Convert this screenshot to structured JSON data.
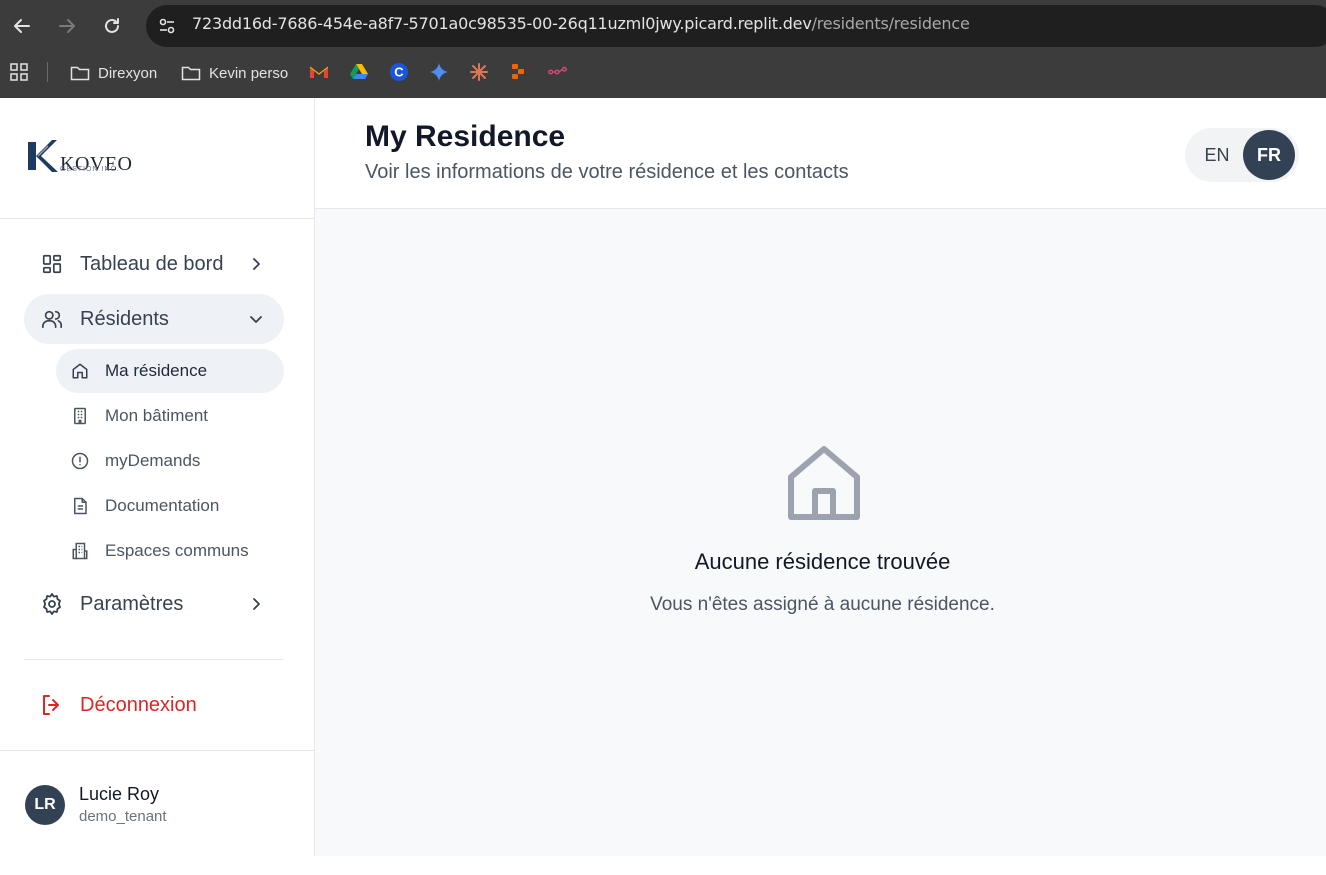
{
  "browser": {
    "url_host": "723dd16d-7686-454e-a8f7-5701a0c98535-00-26q11uzml0jwy.picard.replit.dev",
    "url_path": "/residents/residence",
    "bookmarks": [
      {
        "label": "Direxyon"
      },
      {
        "label": "Kevin perso"
      }
    ]
  },
  "sidebar": {
    "logo": {
      "text": "KOVEO",
      "sub": "GESTION INC."
    },
    "nav": {
      "dashboard": "Tableau de bord",
      "residents": "Résidents",
      "residents_sub": [
        {
          "label": "Ma résidence",
          "icon": "home-icon"
        },
        {
          "label": "Mon bâtiment",
          "icon": "building-icon"
        },
        {
          "label": "myDemands",
          "icon": "alert-circle-icon"
        },
        {
          "label": "Documentation",
          "icon": "document-icon"
        },
        {
          "label": "Espaces communs",
          "icon": "common-spaces-icon"
        }
      ],
      "settings": "Paramètres",
      "logout": "Déconnexion"
    },
    "user": {
      "initials": "LR",
      "name": "Lucie Roy",
      "role": "demo_tenant"
    }
  },
  "header": {
    "title": "My Residence",
    "subtitle": "Voir les informations de votre résidence et les contacts",
    "lang": {
      "en": "EN",
      "fr": "FR",
      "active": "FR"
    }
  },
  "empty_state": {
    "title": "Aucune résidence trouvée",
    "description": "Vous n'êtes assigné à aucune résidence."
  },
  "colors": {
    "accent": "#334155",
    "danger": "#dc2626",
    "active_bg": "#eef2f6"
  }
}
